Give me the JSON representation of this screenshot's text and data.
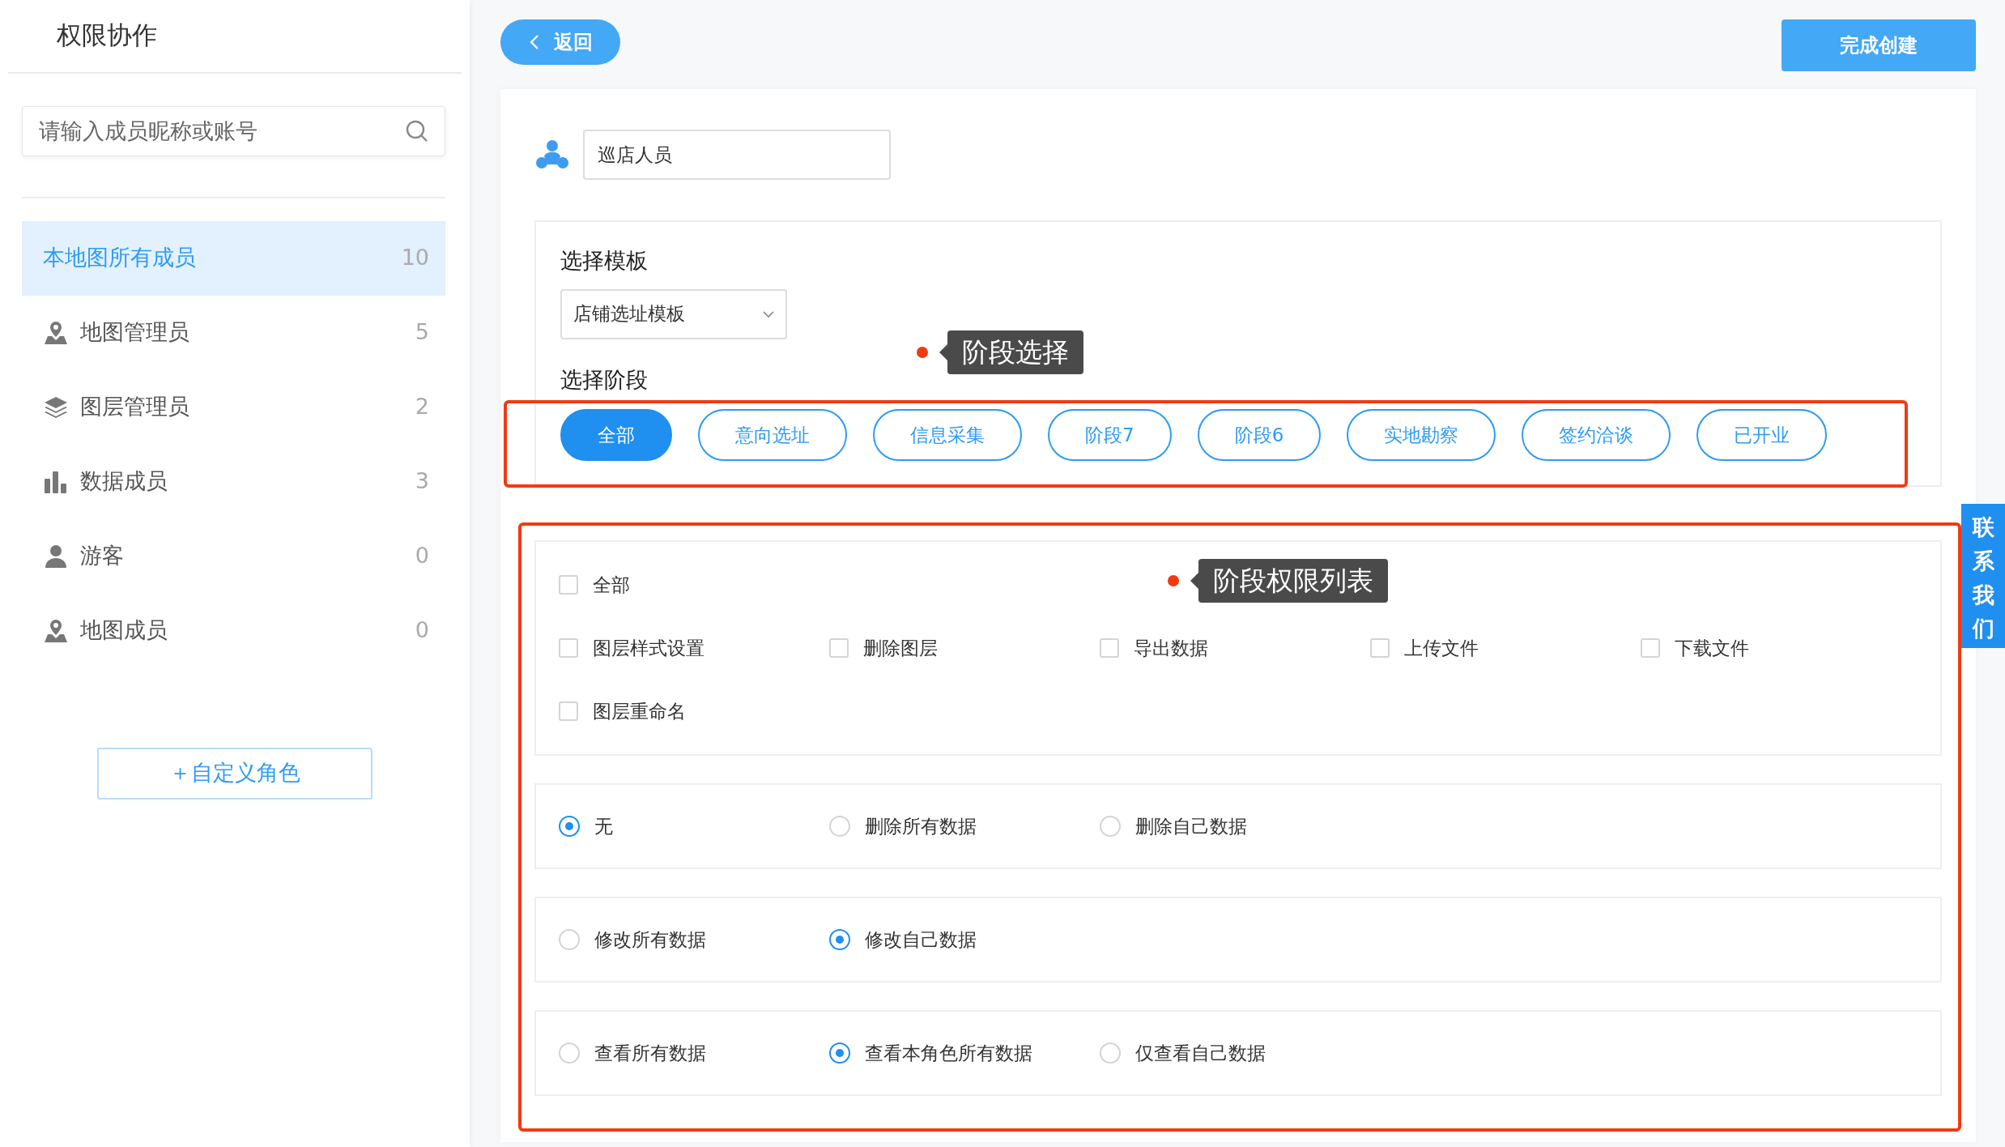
{
  "sidebar": {
    "title": "权限协作",
    "search": {
      "placeholder": "请输入成员昵称或账号"
    },
    "items": [
      {
        "label": "本地图所有成员",
        "count": "10",
        "selected": true
      },
      {
        "label": "地图管理员",
        "count": "5",
        "selected": false
      },
      {
        "label": "图层管理员",
        "count": "2",
        "selected": false
      },
      {
        "label": "数据成员",
        "count": "3",
        "selected": false
      },
      {
        "label": "游客",
        "count": "0",
        "selected": false
      },
      {
        "label": "地图成员",
        "count": "0",
        "selected": false
      }
    ],
    "add_button": "＋自定义角色"
  },
  "back_button": "返回",
  "submit_button": "完成创建",
  "role_name": {
    "value": "巡店人员"
  },
  "template": {
    "label": "选择模板",
    "select": "店铺选址模板"
  },
  "stages": {
    "label": "选择阶段",
    "items": [
      {
        "label": "全部",
        "selected": true
      },
      {
        "label": "意向选址",
        "selected": false
      },
      {
        "label": "信息采集",
        "selected": false
      },
      {
        "label": "阶段7",
        "selected": false
      },
      {
        "label": "阶段6",
        "selected": false
      },
      {
        "label": "实地勘察",
        "selected": false
      },
      {
        "label": "签约洽谈",
        "selected": false
      },
      {
        "label": "已开业",
        "selected": false
      }
    ]
  },
  "permissions": [
    {
      "kind": "checkbox",
      "rows": [
        {
          "items": [
            {
              "label": "全部",
              "checked": false
            }
          ]
        },
        {
          "items": [
            {
              "label": "图层样式设置",
              "checked": false
            },
            {
              "label": "删除图层",
              "checked": false
            },
            {
              "label": "导出数据",
              "checked": false
            },
            {
              "label": "上传文件",
              "checked": false
            },
            {
              "label": "下载文件",
              "checked": false
            }
          ]
        },
        {
          "items": [
            {
              "label": "图层重命名",
              "checked": false
            }
          ]
        }
      ]
    },
    {
      "kind": "radio",
      "rows": [
        {
          "items": [
            {
              "label": "无",
              "selected": true
            },
            {
              "label": "删除所有数据",
              "selected": false
            },
            {
              "label": "删除自己数据",
              "selected": false
            }
          ]
        }
      ]
    },
    {
      "kind": "radio",
      "rows": [
        {
          "items": [
            {
              "label": "修改所有数据",
              "selected": false
            },
            {
              "label": "修改自己数据",
              "selected": true
            }
          ]
        }
      ]
    },
    {
      "kind": "radio",
      "rows": [
        {
          "items": [
            {
              "label": "查看所有数据",
              "selected": false
            },
            {
              "label": "查看本角色所有数据",
              "selected": true
            },
            {
              "label": "仅查看自己数据",
              "selected": false
            }
          ]
        }
      ]
    }
  ],
  "annotations": [
    {
      "text": "阶段选择"
    },
    {
      "text": "阶段权限列表"
    }
  ],
  "contact_tab": "联系我们"
}
